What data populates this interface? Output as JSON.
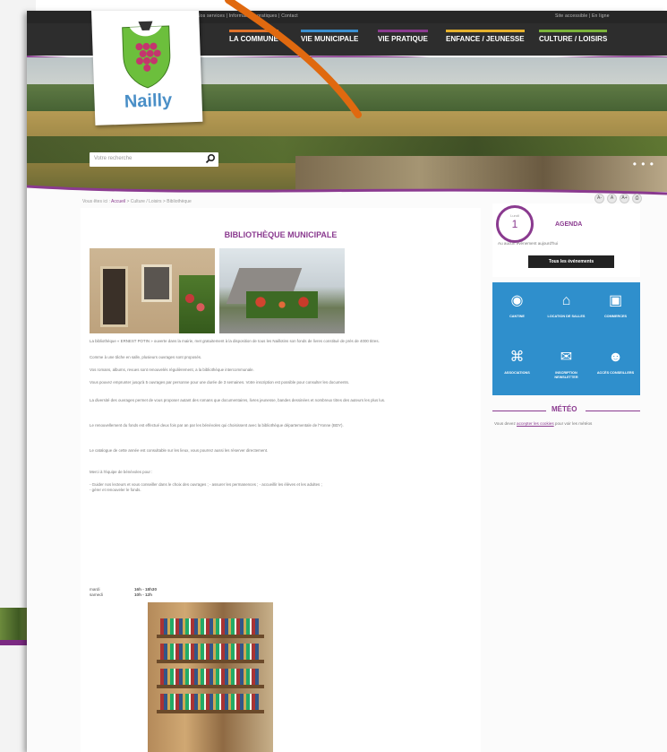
{
  "site": {
    "name": "Nailly",
    "utility_links": "Nos services | Informations pratiques | Contact",
    "utility_right": "Site accessible | En ligne"
  },
  "nav": {
    "items": [
      {
        "label": "LA COMMUNE",
        "color": "#e0722a"
      },
      {
        "label": "VIE MUNICIPALE",
        "color": "#3a8fd0"
      },
      {
        "label": "VIE PRATIQUE",
        "color": "#8a3a8f"
      },
      {
        "label": "ENFANCE / JEUNESSE",
        "color": "#e6b12c"
      },
      {
        "label": "CULTURE / LOISIRS",
        "color": "#7bb33a"
      }
    ]
  },
  "search": {
    "placeholder": "Votre recherche"
  },
  "breadcrumb": {
    "prefix": "Vous êtes ici :",
    "home": "Accueil",
    "path": "> Culture / Loisirs > Bibliothèque"
  },
  "page": {
    "title": "BIBLIOTHÈQUE MUNICIPALE",
    "p1": "La bibliothèque « ERNEST POTIN » ouverte dans la mairie, met gratuitement à la disposition de tous les Naillotins son fonds de livres constitué de près de 4000 titres.",
    "p2": "Comme à une tâche en salle, plusieurs ouvrages sont proposés.",
    "p3": "Vos romans, albums, revues sont renouvelés régulièrement, a la bibliothèque intercommunale.",
    "p4": "Vous pouvez emprunter jusqu'à 5 ouvrages par personne pour une durée de 3 semaines. Votre inscription est possible pour consulter les documents.",
    "p5": "La diversité des ouvrages permet de vous proposer autant des romans que documentaires, livres jeunesse, bandes dessinées et nombreux titres des auteurs les plus lus.",
    "p6": "Le renouvellement du fonds est effectué deux fois par an par les bénévoles qui choisissent avec la bibliothèque départementale de l'Yonne (BDY).",
    "p7": "Le catalogue de cette année est consultable sur les lieux, vous pourrez aussi les réserver directement.",
    "p8": "Merci à l'équipe de bénévoles pour :",
    "p9": "- Guider nos lecteurs et vous conseiller dans le choix des ouvrages ; - assurer les permanences ; - accueillir les élèves et les adultes ; - gérer et renouveler le fonds.",
    "hours": [
      {
        "day": "mardi",
        "time": "16h - 18h30"
      },
      {
        "day": "samedi",
        "time": "10h - 12h"
      }
    ]
  },
  "agenda": {
    "month": "Lundi",
    "day": "1",
    "title": "AGENDA",
    "text": "Au aucun événement aujourd'hui",
    "button": "Tous les événements"
  },
  "quicklinks": [
    {
      "icon": "plate-icon",
      "glyph": "◉",
      "label": "CANTINE"
    },
    {
      "icon": "house-icon",
      "glyph": "⌂",
      "label": "LOCATION DE SALLES"
    },
    {
      "icon": "bag-icon",
      "glyph": "▣",
      "label": "COMMERCES"
    },
    {
      "icon": "network-icon",
      "glyph": "⌘",
      "label": "ASSOCIATIONS"
    },
    {
      "icon": "envelope-icon",
      "glyph": "✉",
      "label": "INSCRIPTION NEWSLETTER"
    },
    {
      "icon": "people-icon",
      "glyph": "☻",
      "label": "ACCÈS CONSEILLERS"
    }
  ],
  "meteo": {
    "title": "MÉTÉO",
    "text": "Vous devez ",
    "link": "accepter les cookies",
    "suffix": " pour voir les météos"
  }
}
